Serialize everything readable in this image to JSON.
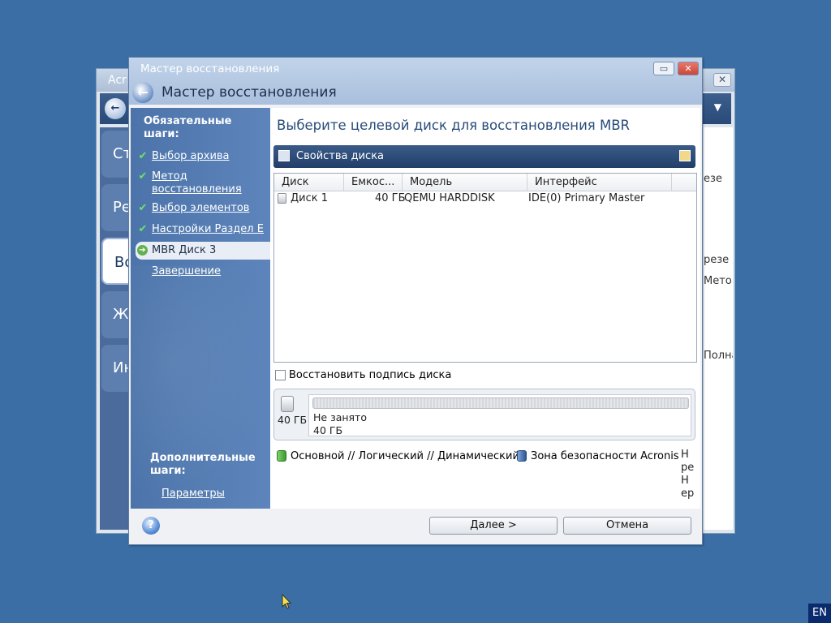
{
  "background_window": {
    "title": "Acr",
    "close_label": "✕",
    "tiles": [
      "Ст",
      "Ре",
      "Во",
      "Ж",
      "Ин"
    ],
    "right_fragments": [
      "езе",
      "резе",
      "Мето",
      "Полна"
    ]
  },
  "wizard": {
    "window_title": "Мастер восстановления",
    "heading": "Мастер восстановления",
    "restore_label": "▭",
    "close_label": "✕",
    "back_label": "←"
  },
  "steps": {
    "required_title": "Обязательные шаги:",
    "items": [
      {
        "label": "Выбор архива",
        "state": "done"
      },
      {
        "label": "Метод восстановления",
        "state": "done"
      },
      {
        "label": "Выбор элементов",
        "state": "done"
      },
      {
        "label": "Настройки Раздел E",
        "state": "done"
      },
      {
        "label": "MBR Диск 3",
        "state": "current"
      },
      {
        "label": "Завершение",
        "state": "pending"
      }
    ],
    "optional_title": "Дополнительные шаги:",
    "optional_items": [
      "Параметры"
    ],
    "check_icon": "✔",
    "arrow_icon": "➔"
  },
  "content": {
    "title": "Выберите целевой диск для восстановления MBR",
    "toolbar_label": "Свойства диска",
    "columns": [
      "Диск",
      "Емкос...",
      "Модель",
      "Интерфейс"
    ],
    "rows": [
      {
        "disk": "Диск 1",
        "capacity": "40 ГБ",
        "model": "QEMU HARDDISK",
        "interface": "IDE(0) Primary Master"
      }
    ],
    "restore_signature_label": "Восстановить подпись диска",
    "restore_signature_checked": false,
    "disk_map": {
      "disk_size": "40 ГБ",
      "partition_name": "Не занято",
      "partition_size": "40 ГБ"
    },
    "legend": [
      {
        "label": "Основной // Логический // Динамический",
        "color": "#4caf3a"
      },
      {
        "label": "Зона безопасности Acronis",
        "color": "#3a6bb0"
      }
    ],
    "legend_cut": "Н ре Н ер"
  },
  "footer": {
    "help_label": "?",
    "next_label": "Далее >",
    "cancel_label": "Отмена"
  },
  "taskbar": {
    "language": "EN"
  }
}
